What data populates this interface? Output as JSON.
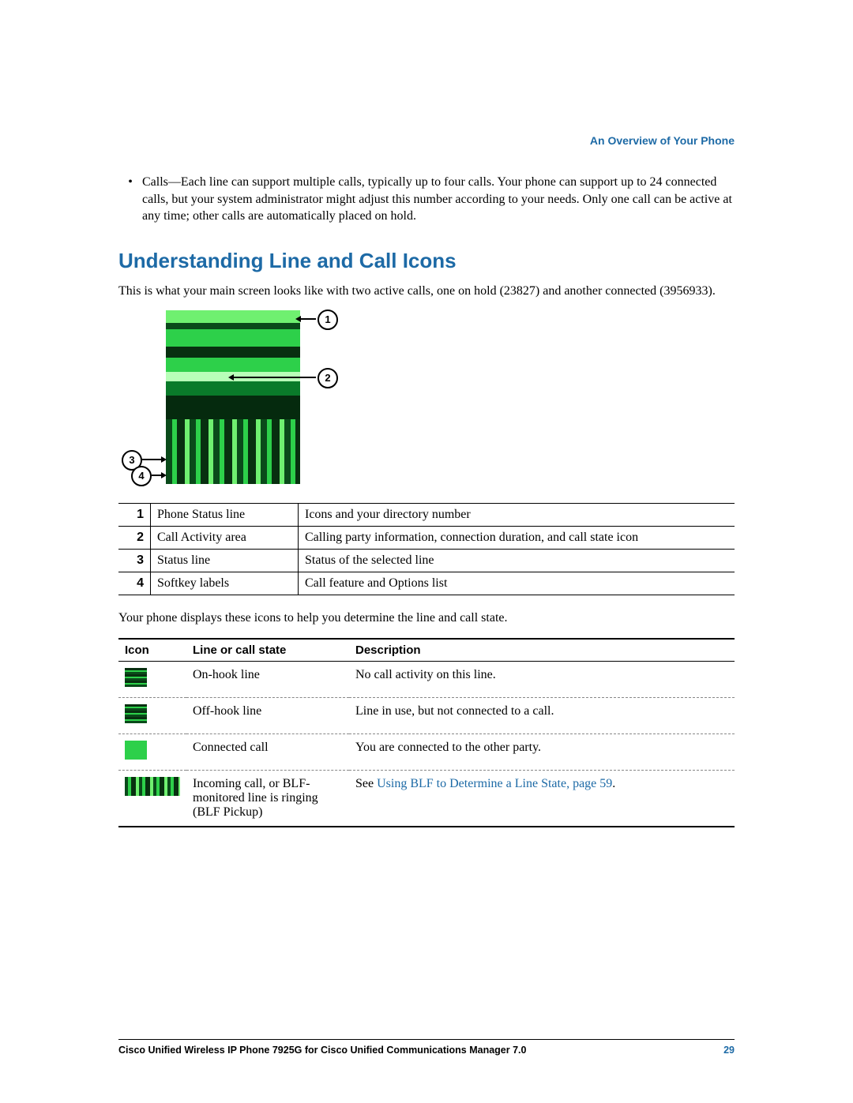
{
  "header": {
    "section": "An Overview of Your Phone"
  },
  "bullet": {
    "text": "Calls—Each line can support multiple calls, typically up to four calls. Your phone can support up to 24 connected calls, but your system administrator might adjust this number according to your needs. Only one call can be active at any time; other calls are automatically placed on hold."
  },
  "section_title": "Understanding Line and Call Icons",
  "intro": "This is what your main screen looks like with two active calls, one on hold (23827) and another connected (3956933).",
  "callouts": {
    "c1": "1",
    "c2": "2",
    "c3": "3",
    "c4": "4"
  },
  "callout_table": [
    {
      "n": "1",
      "term": "Phone Status line",
      "desc": "Icons and your directory number"
    },
    {
      "n": "2",
      "term": "Call Activity area",
      "desc": "Calling party information, connection duration, and call state icon"
    },
    {
      "n": "3",
      "term": "Status line",
      "desc": "Status of the selected line"
    },
    {
      "n": "4",
      "term": "Softkey labels",
      "desc": "Call feature and Options list"
    }
  ],
  "icons_intro": "Your phone displays these icons to help you determine the line and call state.",
  "icon_table": {
    "headers": {
      "icon": "Icon",
      "state": "Line or call state",
      "desc": "Description"
    },
    "rows": [
      {
        "state": "On-hook line",
        "desc": "No call activity on this line.",
        "link": ""
      },
      {
        "state": "Off-hook line",
        "desc": "Line in use, but not connected to a call.",
        "link": ""
      },
      {
        "state": "Connected call",
        "desc": "You are connected to the other party.",
        "link": ""
      },
      {
        "state": "Incoming call, or BLF-monitored line is ringing (BLF Pickup)",
        "desc": "See ",
        "link": "Using BLF to Determine a Line State, page 59",
        "suffix": "."
      }
    ]
  },
  "footer": {
    "title": "Cisco Unified Wireless IP Phone 7925G for Cisco Unified Communications Manager 7.0",
    "page": "29"
  }
}
